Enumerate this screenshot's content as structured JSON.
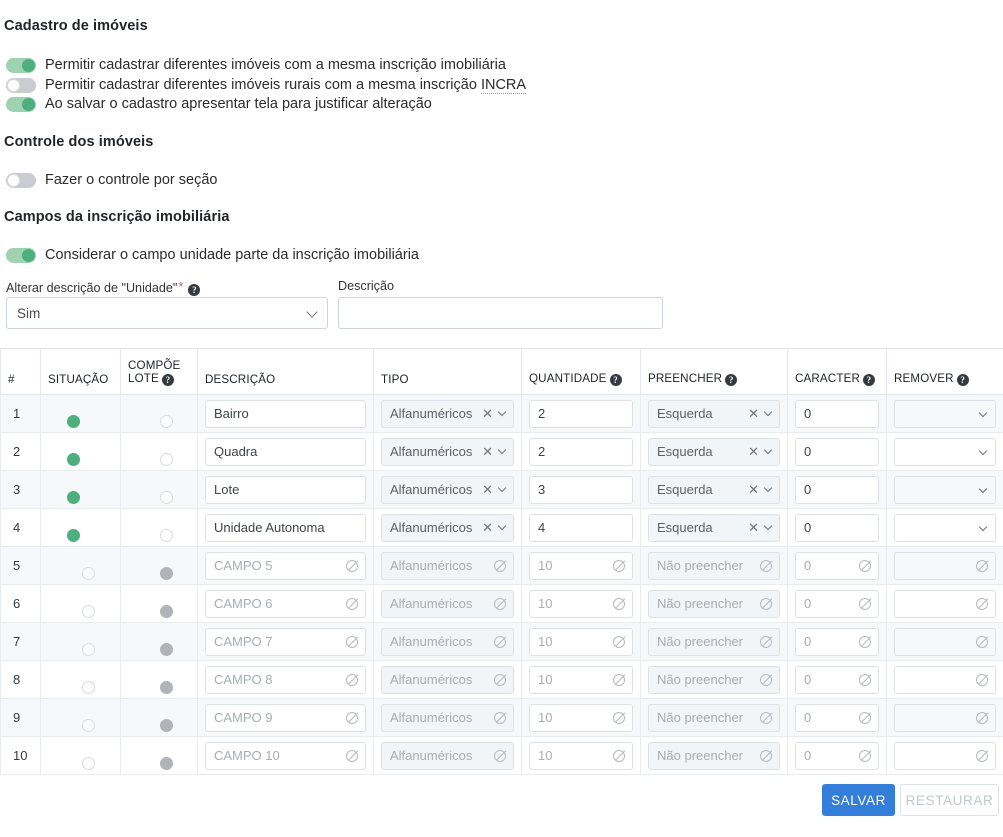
{
  "sections": {
    "cadastro": {
      "title": "Cadastro de imóveis",
      "toggles": [
        {
          "label": "Permitir cadastrar diferentes imóveis com a mesma inscrição imobiliária",
          "state": "on"
        },
        {
          "label": "Permitir cadastrar diferentes imóveis rurais com a mesma inscrição ",
          "abbr": "INCRA",
          "state": "off"
        },
        {
          "label": "Ao salvar o cadastro apresentar tela para justificar alteração",
          "state": "on"
        }
      ]
    },
    "controle": {
      "title": "Controle dos imóveis",
      "toggles": [
        {
          "label": "Fazer o controle por seção",
          "state": "off"
        }
      ]
    },
    "campos": {
      "title": "Campos da inscrição imobiliária",
      "toggles": [
        {
          "label": "Considerar o campo unidade parte da inscrição imobiliária",
          "state": "on"
        }
      ],
      "alterar_descricao": {
        "label": "Alterar descrição de \"Unidade\"",
        "required_marker": "*",
        "help": "?",
        "value": "Sim"
      },
      "descricao": {
        "label": "Descrição",
        "value": "",
        "placeholder": ""
      }
    }
  },
  "table": {
    "headers": [
      {
        "label": "#",
        "help": false
      },
      {
        "label": "SITUAÇÃO",
        "help": false
      },
      {
        "label": "COMPÕE LOTE",
        "help": true
      },
      {
        "label": "DESCRIÇÃO",
        "help": false
      },
      {
        "label": "TIPO",
        "help": false
      },
      {
        "label": "QUANTIDADE",
        "help": true
      },
      {
        "label": "PREENCHER",
        "help": true
      },
      {
        "label": "CARACTER",
        "help": true
      },
      {
        "label": "REMOVER",
        "help": true
      }
    ],
    "rows": [
      {
        "num": "1",
        "situacao": "on",
        "compoe": "off",
        "descricao": "Bairro",
        "desc_is_placeholder": false,
        "tipo": "Alfanuméricos",
        "tipo_empty": false,
        "quantidade": "2",
        "qtd_is_placeholder": false,
        "preencher": "Esquerda",
        "pre_empty": false,
        "caracter": "0",
        "car_is_placeholder": false,
        "remover": "",
        "enabled": true
      },
      {
        "num": "2",
        "situacao": "on",
        "compoe": "off",
        "descricao": "Quadra",
        "desc_is_placeholder": false,
        "tipo": "Alfanuméricos",
        "tipo_empty": false,
        "quantidade": "2",
        "qtd_is_placeholder": false,
        "preencher": "Esquerda",
        "pre_empty": false,
        "caracter": "0",
        "car_is_placeholder": false,
        "remover": "",
        "enabled": true
      },
      {
        "num": "3",
        "situacao": "on",
        "compoe": "off",
        "descricao": "Lote",
        "desc_is_placeholder": false,
        "tipo": "Alfanuméricos",
        "tipo_empty": false,
        "quantidade": "3",
        "qtd_is_placeholder": false,
        "preencher": "Esquerda",
        "pre_empty": false,
        "caracter": "0",
        "car_is_placeholder": false,
        "remover": "",
        "enabled": true
      },
      {
        "num": "4",
        "situacao": "on",
        "compoe": "off",
        "descricao": "Unidade Autonoma",
        "desc_is_placeholder": false,
        "tipo": "Alfanuméricos",
        "tipo_empty": false,
        "quantidade": "4",
        "qtd_is_placeholder": false,
        "preencher": "Esquerda",
        "pre_empty": false,
        "caracter": "0",
        "car_is_placeholder": false,
        "remover": "",
        "enabled": true
      },
      {
        "num": "5",
        "situacao": "off",
        "compoe": "off",
        "descricao": "CAMPO 5",
        "desc_is_placeholder": true,
        "tipo": "Alfanuméricos",
        "tipo_empty": true,
        "quantidade": "10",
        "qtd_is_placeholder": true,
        "preencher": "Não preencher",
        "pre_empty": true,
        "caracter": "0",
        "car_is_placeholder": true,
        "remover": "",
        "enabled": false
      },
      {
        "num": "6",
        "situacao": "off",
        "compoe": "off",
        "descricao": "CAMPO 6",
        "desc_is_placeholder": true,
        "tipo": "Alfanuméricos",
        "tipo_empty": true,
        "quantidade": "10",
        "qtd_is_placeholder": true,
        "preencher": "Não preencher",
        "pre_empty": true,
        "caracter": "0",
        "car_is_placeholder": true,
        "remover": "",
        "enabled": false
      },
      {
        "num": "7",
        "situacao": "off",
        "compoe": "off",
        "descricao": "CAMPO 7",
        "desc_is_placeholder": true,
        "tipo": "Alfanuméricos",
        "tipo_empty": true,
        "quantidade": "10",
        "qtd_is_placeholder": true,
        "preencher": "Não preencher",
        "pre_empty": true,
        "caracter": "0",
        "car_is_placeholder": true,
        "remover": "",
        "enabled": false
      },
      {
        "num": "8",
        "situacao": "off",
        "compoe": "off",
        "descricao": "CAMPO 8",
        "desc_is_placeholder": true,
        "tipo": "Alfanuméricos",
        "tipo_empty": true,
        "quantidade": "10",
        "qtd_is_placeholder": true,
        "preencher": "Não preencher",
        "pre_empty": true,
        "caracter": "0",
        "car_is_placeholder": true,
        "remover": "",
        "enabled": false
      },
      {
        "num": "9",
        "situacao": "off",
        "compoe": "off",
        "descricao": "CAMPO 9",
        "desc_is_placeholder": true,
        "tipo": "Alfanuméricos",
        "tipo_empty": true,
        "quantidade": "10",
        "qtd_is_placeholder": true,
        "preencher": "Não preencher",
        "pre_empty": true,
        "caracter": "0",
        "car_is_placeholder": true,
        "remover": "",
        "enabled": false
      },
      {
        "num": "10",
        "situacao": "off",
        "compoe": "off",
        "descricao": "CAMPO 10",
        "desc_is_placeholder": true,
        "tipo": "Alfanuméricos",
        "tipo_empty": true,
        "quantidade": "10",
        "qtd_is_placeholder": true,
        "preencher": "Não preencher",
        "pre_empty": true,
        "caracter": "0",
        "car_is_placeholder": true,
        "remover": "",
        "enabled": false
      }
    ]
  },
  "footer": {
    "save_label": "SALVAR",
    "restore_label": "RESTAURAR"
  },
  "colors": {
    "toggle_on_track": "#9ed2b0",
    "toggle_on_knob": "#4caf7d",
    "toggle_off_track": "#c9ccd1",
    "toggle_disabled_knob": "#b0b3b8",
    "primary_button": "#337ed8",
    "required_star": "#d9534f",
    "row_stripe": "#f6f8fa",
    "help_icon": "#343a40"
  },
  "icons": {
    "help": "help-circle-icon",
    "chevron": "chevron-down-icon",
    "clear": "clear-x-icon",
    "disabled": "not-allowed-icon"
  }
}
